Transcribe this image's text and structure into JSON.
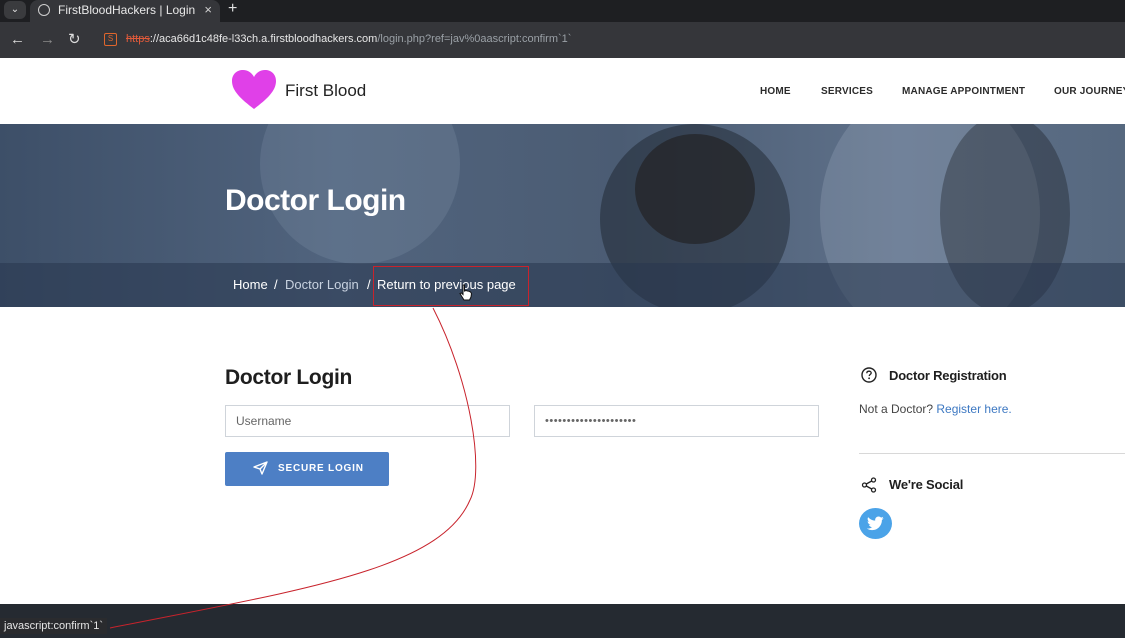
{
  "browser": {
    "tab_menu_icon": "chevron-down-icon",
    "tab_title": "FirstBloodHackers | Login",
    "new_tab_symbol": "+",
    "close_symbol": "×",
    "back_symbol": "←",
    "forward_symbol": "→",
    "reload_symbol": "↻",
    "url_scheme": "https",
    "url_host": "://aca66d1c48fe-l33ch.a.firstbloodhackers.com",
    "url_path": "/login.php?ref=jav%0aascript:confirm`1`"
  },
  "header": {
    "logo_text": "First Blood",
    "logo_color": "#e040e8",
    "nav": [
      "HOME",
      "SERVICES",
      "MANAGE APPOINTMENT",
      "OUR JOURNEY"
    ]
  },
  "hero": {
    "title": "Doctor Login",
    "breadcrumb": {
      "home": "Home",
      "sep": "/",
      "current": "Doctor Login",
      "return": "Return to previous page"
    }
  },
  "login": {
    "title": "Doctor Login",
    "username_placeholder": "Username",
    "password_value": "•••••••••••••••••••••",
    "button_label": "SECURE LOGIN",
    "button_color": "#4d7fc5"
  },
  "sidebar": {
    "registration_heading": "Doctor Registration",
    "registration_text": "Not a Doctor? ",
    "registration_link": "Register here.",
    "social_heading": "We're Social",
    "twitter_color": "#4ba3e8"
  },
  "status_bar": {
    "text": "javascript:confirm`1`"
  },
  "annotation_color": "#c8232c"
}
